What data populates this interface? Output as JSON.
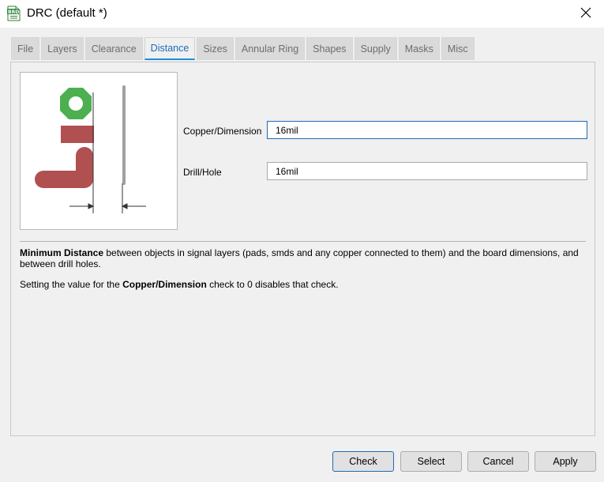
{
  "window": {
    "title": "DRC (default *)",
    "icon_label": "BRD"
  },
  "tabs": [
    {
      "label": "File",
      "active": false
    },
    {
      "label": "Layers",
      "active": false
    },
    {
      "label": "Clearance",
      "active": false
    },
    {
      "label": "Distance",
      "active": true
    },
    {
      "label": "Sizes",
      "active": false
    },
    {
      "label": "Annular Ring",
      "active": false
    },
    {
      "label": "Shapes",
      "active": false
    },
    {
      "label": "Supply",
      "active": false
    },
    {
      "label": "Masks",
      "active": false
    },
    {
      "label": "Misc",
      "active": false
    }
  ],
  "fields": {
    "copper_dimension": {
      "label": "Copper/Dimension",
      "value": "16mil"
    },
    "drill_hole": {
      "label": "Drill/Hole",
      "value": "16mil"
    }
  },
  "description": {
    "p1_bold": "Minimum Distance",
    "p1_rest": " between objects in signal layers (pads, smds and any copper connected to them) and the board dimensions, and between drill holes.",
    "p2_pre": "Setting the value for the ",
    "p2_bold": "Copper/Dimension",
    "p2_post": " check to 0 disables that check."
  },
  "buttons": {
    "check": "Check",
    "select": "Select",
    "cancel": "Cancel",
    "apply": "Apply"
  },
  "colors": {
    "pad_green": "#4caf50",
    "copper_red": "#b05050",
    "dimension_gray": "#a0a0a0",
    "active_tab": "#1d6bb8"
  },
  "icons": {
    "app": "brd-file-icon",
    "close": "close-icon"
  }
}
